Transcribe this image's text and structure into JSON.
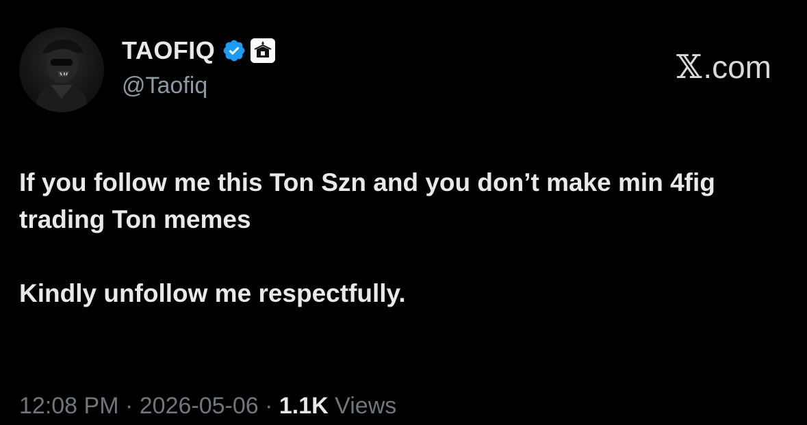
{
  "author": {
    "display_name": "TAOFIQ",
    "handle": "@Taofiq",
    "verified_icon": "verified-badge-icon",
    "affiliate_icon": "affiliate-badge-icon"
  },
  "brand": {
    "x_glyph": "𝕏",
    "domain": ".com"
  },
  "post": {
    "line1": "If you follow me this Ton Szn and you don’t make min 4fig trading Ton memes",
    "line2": "Kindly unfollow me respectfully."
  },
  "meta": {
    "time": "12:08 PM",
    "sep1": " · ",
    "date": "2026-05-06",
    "sep2": " · ",
    "views_count": "1.1K",
    "views_label": " Views"
  },
  "colors": {
    "background": "#000000",
    "primary_text": "#e7e9ea",
    "secondary_text": "#71767b",
    "verified_blue": "#1d9bf0"
  }
}
